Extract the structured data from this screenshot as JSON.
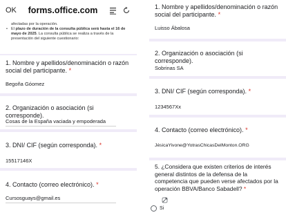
{
  "left": {
    "topbar": {
      "ok": "OK",
      "domain": "forms.office.com",
      "icons": [
        "menu-icon",
        "refresh-icon"
      ]
    },
    "intro": {
      "line0": "afectadas por la operación.",
      "bullet_pre": "El ",
      "bullet_bold": "plazo de duración de la consulta pública será hasta el 16 de mayo de 2025",
      "bullet_post": ". La consulta pública se realiza a través de la presentación del siguiente cuestionario:"
    },
    "questions": [
      {
        "title": "1. Nombre y apellidos/denominación o razón social del participante.",
        "required": " *",
        "answer": "Begoña Góomez"
      },
      {
        "title": "2. Organización o asociación (si corresponde).",
        "required": "",
        "answer": "Cosas de la España vaciada y empoderada"
      },
      {
        "title": "3. DNI/ CIF (según corresponda).",
        "required": " *",
        "answer": "15517146X"
      },
      {
        "title": "4. Contacto (correo electrónico).",
        "required": " *",
        "answer": "Cursosguays@gmail.es"
      }
    ]
  },
  "right": {
    "questions": [
      {
        "title": "1. Nombre y apellidos/denominación o razón social del participante.",
        "required": " *",
        "answer": "Luisso Ábalosa"
      },
      {
        "title": "2. Organización o asociación (si corresponde).",
        "required": "",
        "answer": "Sobrinas SA"
      },
      {
        "title": "3. DNI/ CIF (según corresponda).",
        "required": " *",
        "answer": "1234567Xx"
      },
      {
        "title": "4. Contacto (correo electrónico).",
        "required": " *",
        "answer": "JésicaYivone@YotrasChicasDelMonton.ORG"
      },
      {
        "title": "5. ¿Considera que existen criterios de interés general distintos de la defensa de la competencia que pueden verse afectados por la operación BBVA/Banco Sabadell?",
        "required": " *",
        "answer": ""
      }
    ],
    "option_si": "Si"
  }
}
